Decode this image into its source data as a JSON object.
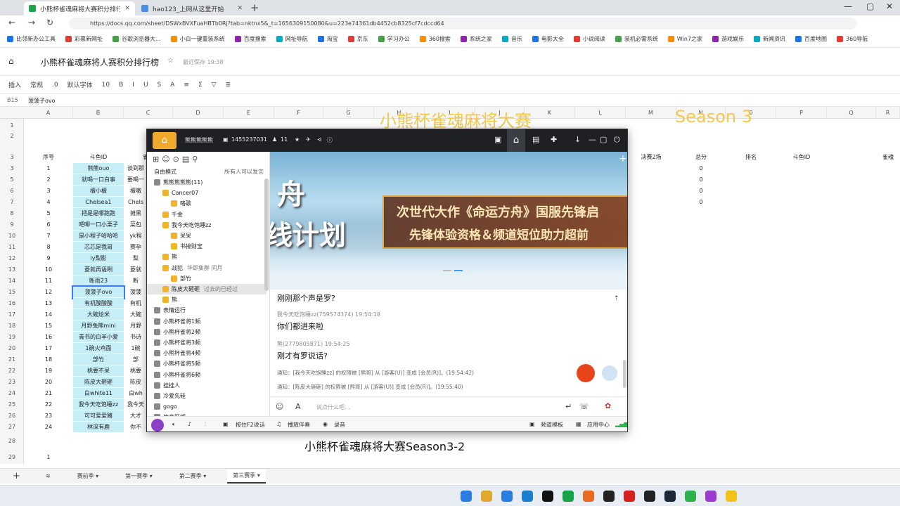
{
  "browser": {
    "tabs": [
      {
        "label": "小熊杯雀魂麻将大赛积分排行榜",
        "active": true
      },
      {
        "label": "hao123_上网从这里开始",
        "active": false
      }
    ],
    "url": "https://docs.qq.com/sheet/DSWxBVXFuaHBTb0Rj?tab=nktnx5&_t=1656309150080&u=223e74361db4452cb8325cf7cdccd64",
    "bookmarks": [
      "比邻新办公工具",
      "彩票新网址",
      "谷歌浏览器大...",
      "小白一键重装系统",
      "百度搜索",
      "网址导航",
      "淘宝",
      "京东",
      "学习办公",
      "360搜索",
      "系统之家",
      "音乐",
      "电影大全",
      "小说阅读",
      "装机必需系统",
      "Win7之家",
      "游戏娱乐",
      "新闻资讯",
      "百度地图",
      "360导航"
    ]
  },
  "doc": {
    "title": "小熊杯雀魂麻将人赛积分排行榜",
    "saved": "最近保存 19:38",
    "cell_ref": "B15",
    "cell_value": "菠菠子ovo"
  },
  "toolbar": [
    "插入",
    "常规",
    ".0",
    "默认字体",
    "10",
    "B",
    "I",
    "U",
    "S",
    "A",
    "≡",
    "Σ",
    "▽",
    "≣"
  ],
  "sheet": {
    "columns": [
      "A",
      "B",
      "C",
      "D",
      "E",
      "F",
      "G",
      "H",
      "I",
      "J",
      "K",
      "L",
      "M",
      "N",
      "O",
      "P",
      "Q",
      "R"
    ],
    "header_row": {
      "a": "序号",
      "b": "斗鱼ID",
      "c": "雀魂",
      "m": "决赛2场",
      "n": "总分",
      "o": "排名",
      "p": "斗鱼ID",
      "r": "雀魂"
    },
    "rows": [
      {
        "rn": "3",
        "a": "",
        "b": "",
        "c": ""
      },
      {
        "rn": "3",
        "a": "1",
        "b": "熊熊ouo",
        "c": "谈到那"
      },
      {
        "rn": "5",
        "a": "2",
        "b": "就喝一口白事",
        "c": "要喝一"
      },
      {
        "rn": "6",
        "a": "3",
        "b": "檀小檀",
        "c": "檀嗷"
      },
      {
        "rn": "7",
        "a": "4",
        "b": "Chelsea1",
        "c": "Chels"
      },
      {
        "rn": "8",
        "a": "5",
        "b": "把是是哪跑跑",
        "c": "摊黑"
      },
      {
        "rn": "9",
        "a": "6",
        "b": "吧唧一口小栗子",
        "c": "菜包"
      },
      {
        "rn": "10",
        "a": "7",
        "b": "是小程子哈哈哈",
        "c": "yk程"
      },
      {
        "rn": "11",
        "a": "8",
        "b": "芯芯是我哥",
        "c": "赛孕"
      },
      {
        "rn": "12",
        "a": "9",
        "b": "ly梨影",
        "c": "梨"
      },
      {
        "rn": "13",
        "a": "10",
        "b": "菱就再语咧",
        "c": "菱就"
      },
      {
        "rn": "14",
        "a": "11",
        "b": "断雨23",
        "c": "断"
      },
      {
        "rn": "15",
        "a": "12",
        "b": "菠菠子ovo",
        "c": "菠菠"
      },
      {
        "rn": "16",
        "a": "13",
        "b": "有机酸酸酸",
        "c": "有机"
      },
      {
        "rn": "17",
        "a": "14",
        "b": "大碗烩米",
        "c": "大碗"
      },
      {
        "rn": "18",
        "a": "15",
        "b": "月野兔熊mini",
        "c": "月野"
      },
      {
        "rn": "19",
        "a": "16",
        "b": "青书的白羊小爱",
        "c": "书诗"
      },
      {
        "rn": "20",
        "a": "17",
        "b": "1碗火鸡面",
        "c": "1碗"
      },
      {
        "rn": "21",
        "a": "18",
        "b": "部竹",
        "c": "部"
      },
      {
        "rn": "22",
        "a": "19",
        "b": "桃要不呆",
        "c": "桃要"
      },
      {
        "rn": "23",
        "a": "20",
        "b": "陈皮大砸砸",
        "c": "陈皮"
      },
      {
        "rn": "24",
        "a": "21",
        "b": "白white11",
        "c": "白wh"
      },
      {
        "rn": "25",
        "a": "22",
        "b": "我今天吃饱睡zz",
        "c": "我今天"
      },
      {
        "rn": "26",
        "a": "23",
        "b": "可可爱爱猪",
        "c": "大才"
      },
      {
        "rn": "27",
        "a": "24",
        "b": "林深有鹿",
        "c": "你不"
      }
    ],
    "right_rows": [
      "0",
      "0",
      "0",
      "0"
    ],
    "row28": "28",
    "row29": {
      "rn": "29",
      "a": "1"
    },
    "big_title": "小熊杯雀魂麻将大赛",
    "big_title_2": "Season 3",
    "sheet_tabs": [
      "赛前季",
      "第一赛季",
      "第二赛季",
      "第三赛季"
    ],
    "active_sheet": 3
  },
  "app": {
    "name": "熊熊熊熊熊",
    "channel_id": "1455237031",
    "online": "11",
    "side_tabs": "自由模式",
    "side_perm": "所有人可以发言",
    "tree": [
      {
        "label": "熊熊熊熊熊(11)",
        "level": 0
      },
      {
        "label": "Cancer07",
        "level": 1
      },
      {
        "label": "咯歌",
        "level": 2
      },
      {
        "label": "千金",
        "level": 1
      },
      {
        "label": "我今天吃饱睡zz",
        "level": 1
      },
      {
        "label": "呆呆",
        "level": 2
      },
      {
        "label": "书接财宝",
        "level": 2
      },
      {
        "label": "熊",
        "level": 1
      },
      {
        "label": "战犯",
        "level": 1,
        "extra": "华即集群 问月"
      },
      {
        "label": "部竹",
        "level": 2
      },
      {
        "label": "陈皮大砸砸",
        "level": 1,
        "extra": "过去的已经过"
      },
      {
        "label": "熊",
        "level": 1
      },
      {
        "label": "表情运行",
        "level": 0
      },
      {
        "label": "小熊杯雀将1频",
        "level": 0
      },
      {
        "label": "小熊杯雀将2频",
        "level": 0
      },
      {
        "label": "小熊杯雀将3频",
        "level": 0
      },
      {
        "label": "小熊杯雀将4频",
        "level": 0
      },
      {
        "label": "小熊杯雀将5频",
        "level": 0
      },
      {
        "label": "小熊杯雀将6频",
        "level": 0
      },
      {
        "label": "挂挂人",
        "level": 0
      },
      {
        "label": "冷爱先硅",
        "level": 0
      },
      {
        "label": "gogo",
        "level": 0
      },
      {
        "label": "休息区域",
        "level": 0
      }
    ],
    "banner_line1": "次世代大作《命运方舟》国服先锋启",
    "banner_line2": "先锋体验资格＆频道短位助力超前",
    "banner_left_big": "舟",
    "banner_left_big2": "线计划",
    "messages": [
      {
        "type": "text",
        "text": "刚刚那个声是罗?"
      },
      {
        "type": "meta",
        "text": "我今天吃饱睡zz(759574374)  19:54:18"
      },
      {
        "type": "text",
        "text": "你们都进来啦"
      },
      {
        "type": "meta",
        "text": "熊(2779805871)  19:54:25"
      },
      {
        "type": "text",
        "text": "刚才有罗说话?"
      },
      {
        "type": "sys",
        "text": "通知：[我今天吃饱睡zz] 的权限被 [熊哥] 从 [游客(U)] 变成 [会员(R)]。(19:54:42)"
      },
      {
        "type": "sys",
        "text": "通知：[陈皮大砸砸] 的权限被 [熊哥] 从 [游客(U)] 变成 [会员(R)]。(19:55:40)"
      }
    ],
    "input_placeholder": "说点什么吧...",
    "bottom": [
      "按住F2说话",
      "播放伴奏",
      "录音",
      "频道模板",
      "应用中心"
    ]
  },
  "caption": "小熊杯雀魂麻将大赛Season3-2",
  "colors": {
    "cyan": "#c5eef7",
    "select": "#3d7cf5",
    "gold": "#f2c94c",
    "appbar": "#1e2024"
  }
}
